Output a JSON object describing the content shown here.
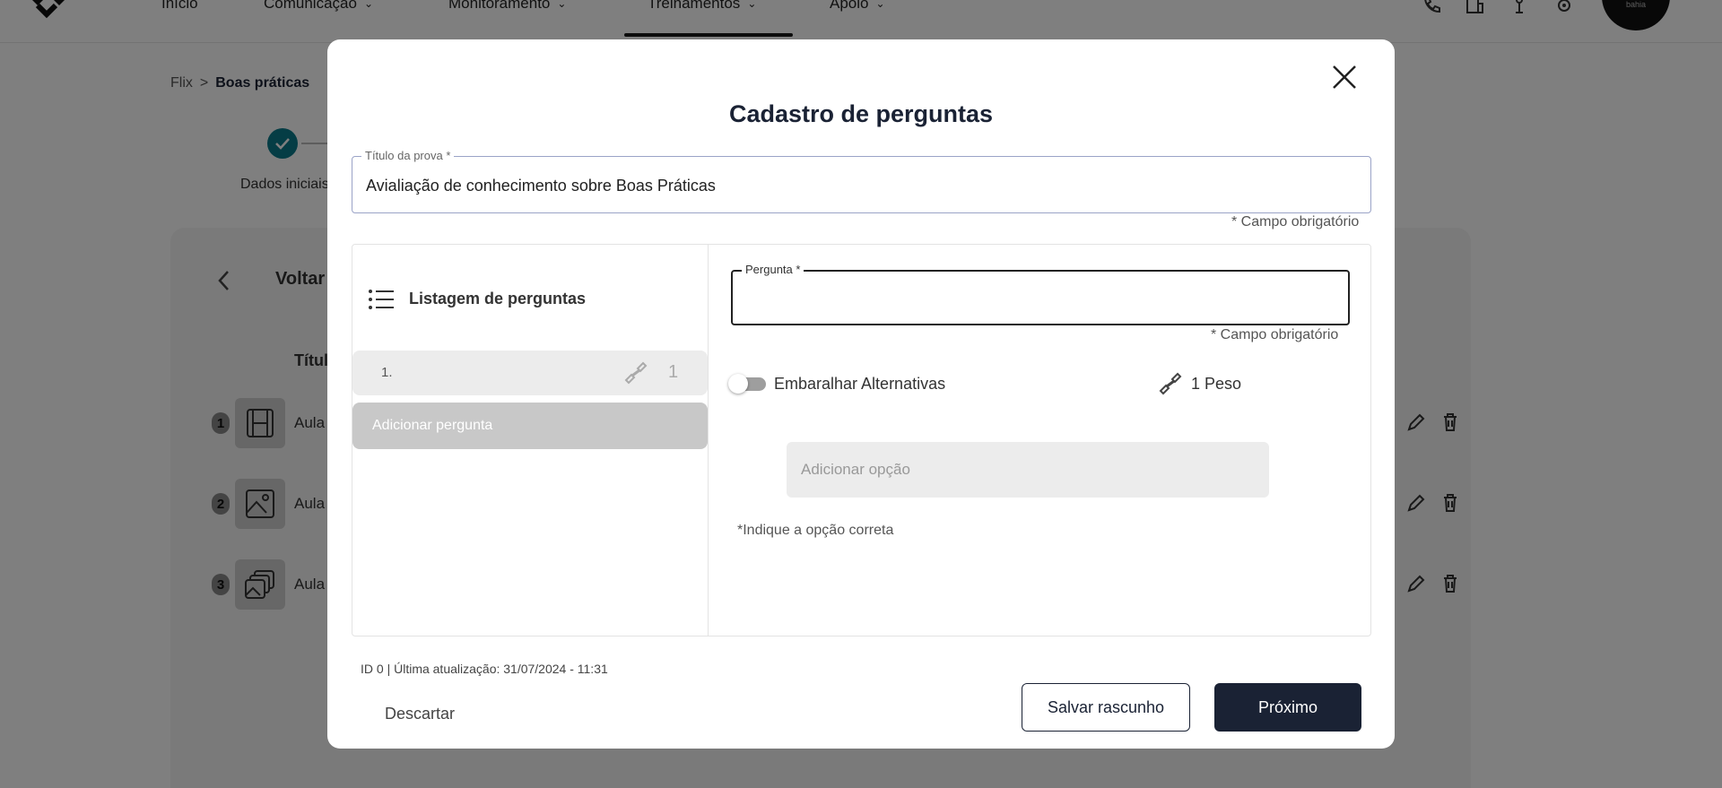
{
  "nav": {
    "items": [
      "Início",
      "Comunicação",
      "Monitoramento",
      "Treinamentos",
      "Apoio"
    ],
    "active": "Treinamentos",
    "avatar_text": "bahia"
  },
  "breadcrumb": {
    "root": "Flix",
    "separator": ">",
    "current": "Boas práticas"
  },
  "stepper": {
    "step1_label": "Dados iniciais"
  },
  "background": {
    "back_label": "Voltar",
    "column_title": "Títul",
    "lessons": [
      {
        "number": "1",
        "label": "Aula",
        "icon": "film-icon"
      },
      {
        "number": "2",
        "label": "Aula",
        "icon": "image-icon"
      },
      {
        "number": "3",
        "label": "Aula",
        "icon": "gallery-icon"
      }
    ]
  },
  "modal": {
    "title": "Cadastro de perguntas",
    "exam_title_label": "Título da prova *",
    "exam_title_value": "Avialiação de conhecimento sobre Boas Práticas",
    "required_note": "* Campo obrigatório",
    "questions_list": {
      "title": "Listagem de perguntas",
      "items": [
        {
          "number": "1.",
          "weight": "1"
        }
      ],
      "add_label": "Adicionar pergunta"
    },
    "question_form": {
      "label": "Pergunta *",
      "value": "",
      "required_note": "* Campo obrigatório",
      "shuffle_label": "Embaralhar Alternativas",
      "shuffle_on": false,
      "weight_label": "1 Peso",
      "add_option_placeholder": "Adicionar opção",
      "hint": "*Indique a opção correta"
    },
    "meta": "ID 0 | Última atualização: 31/07/2024 - 11:31",
    "buttons": {
      "discard": "Descartar",
      "save_draft": "Salvar rascunho",
      "next": "Próximo"
    }
  },
  "colors": {
    "primary": "#1a2234",
    "accent": "#0b7a8a",
    "overlay": "rgba(0,0,0,0.5)"
  }
}
